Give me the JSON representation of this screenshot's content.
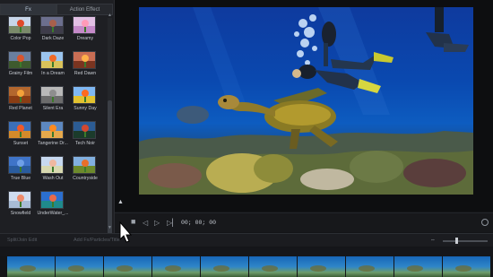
{
  "tabs": [
    {
      "label": "Fx",
      "active": true
    },
    {
      "label": "Action Effect",
      "active": false
    }
  ],
  "effects": [
    {
      "label": "Color Pop",
      "sky": "#c8d6ea",
      "ground": "#7a8a6a",
      "flower": "#e04a2a"
    },
    {
      "label": "Dark Daze",
      "sky": "#6c6f8e",
      "ground": "#3e3c4a",
      "flower": "#a8604c"
    },
    {
      "label": "Dreamy",
      "sky": "#e2c0e4",
      "ground": "#c58ac9",
      "flower": "#ff9ab8"
    },
    {
      "label": "Grainy Film",
      "sky": "#6a7fa0",
      "ground": "#3e5a2e",
      "flower": "#d8552e"
    },
    {
      "label": "In a Dream",
      "sky": "#9bc5ef",
      "ground": "#d9c25a",
      "flower": "#f06a28"
    },
    {
      "label": "Red Dawn",
      "sky": "#c96e54",
      "ground": "#7a3420",
      "flower": "#ffb04a"
    },
    {
      "label": "Red Planet",
      "sky": "#b3672e",
      "ground": "#8a3d14",
      "flower": "#f4a23a"
    },
    {
      "label": "Silent Era",
      "sky": "#b9b9b9",
      "ground": "#6c6c6c",
      "flower": "#8e8e8e"
    },
    {
      "label": "Sunny Day",
      "sky": "#7fb8f3",
      "ground": "#e2c230",
      "flower": "#ff6a1e"
    },
    {
      "label": "Sunset",
      "sky": "#3c6fb8",
      "ground": "#d48a2a",
      "flower": "#f05a2a"
    },
    {
      "label": "Tangerine Dr...",
      "sky": "#5d88c0",
      "ground": "#e6a94c",
      "flower": "#ff8a1e"
    },
    {
      "label": "Tech Noir",
      "sky": "#2c5c94",
      "ground": "#1b3b2b",
      "flower": "#d24830"
    },
    {
      "label": "True Blue",
      "sky": "#3f74c8",
      "ground": "#2a5c9e",
      "flower": "#6ea0e8"
    },
    {
      "label": "Wash Out",
      "sky": "#c7d9f0",
      "ground": "#d8d9b0",
      "flower": "#efb8a0"
    },
    {
      "label": "Countryside",
      "sky": "#82b0e0",
      "ground": "#6d8a2c",
      "flower": "#e86f2a"
    },
    {
      "label": "Snowfield",
      "sky": "#cfdcef",
      "ground": "#a8bcd6",
      "flower": "#ee8a6a"
    },
    {
      "label": "UnderWater_...",
      "sky": "#2b6fcf",
      "ground": "#1f8a8c",
      "flower": "#e86a4a"
    }
  ],
  "player": {
    "timecode": "00; 00; 00"
  },
  "timeline": {
    "left_button": "Split/Join Edit",
    "right_button": "Add Fx/Particles/Title"
  }
}
